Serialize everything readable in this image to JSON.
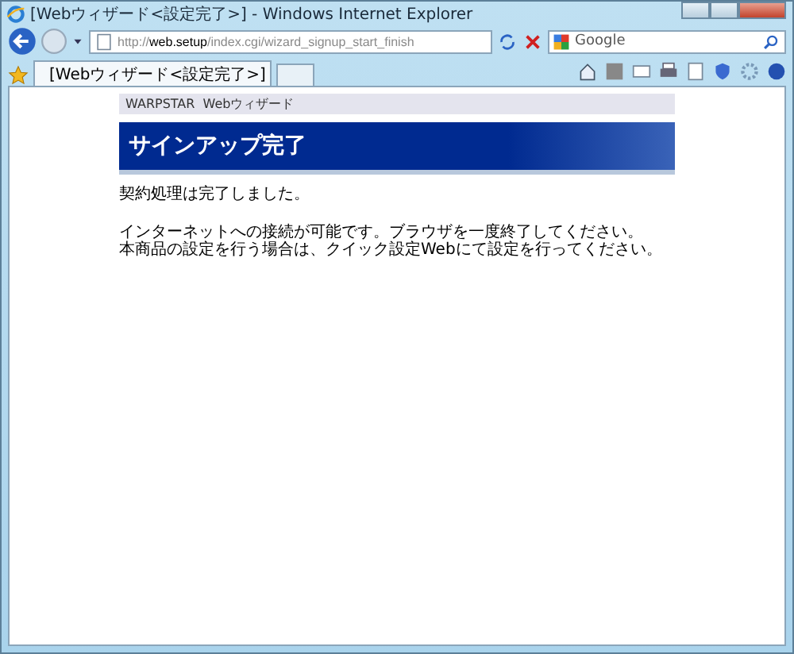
{
  "window": {
    "title": "[Webウィザード<設定完了>] - Windows Internet Explorer"
  },
  "address_bar": {
    "scheme": "http://",
    "host": "web.setup",
    "path": "/index.cgi/wizard_signup_start_finish"
  },
  "search": {
    "placeholder": "Google"
  },
  "tabs": [
    {
      "label": "[Webウィザード<設定完了>]",
      "selected": true
    }
  ],
  "page": {
    "header": "WARPSTAR  Webウィザード",
    "heading": "サインアップ完了",
    "paragraphs": [
      {
        "lines": [
          "契約処理は完了しました。"
        ]
      },
      {
        "lines": [
          "インターネットへの接続が可能です。ブラウザを一度終了してください。",
          "本商品の設定を行う場合は、クイック設定Webにて設定を行ってください。"
        ]
      }
    ]
  }
}
